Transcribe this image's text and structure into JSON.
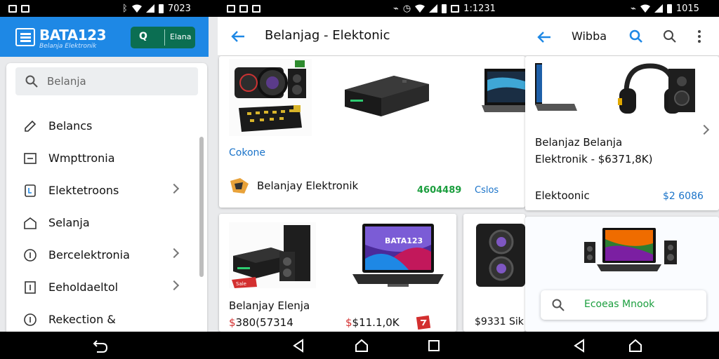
{
  "status_bar": {
    "left_time": "7023",
    "mid_time": "1:1231",
    "right_time": "1015"
  },
  "drawer": {
    "brand": "BATA123",
    "brand_sub": "Belanja Elektronik",
    "header_button": {
      "icon_letter": "Q",
      "label": "Elana"
    },
    "search_placeholder": "Belanja",
    "items": [
      {
        "label": "Belancs",
        "icon": "edit-icon",
        "chevron": false
      },
      {
        "label": "Wmpttronia",
        "icon": "box-icon",
        "chevron": false
      },
      {
        "label": "Elektetroons",
        "icon": "bookmark-icon",
        "chevron": true
      },
      {
        "label": "Selanja",
        "icon": "home-icon",
        "chevron": false
      },
      {
        "label": "Bercelektronia",
        "icon": "info-icon",
        "chevron": true
      },
      {
        "label": "Eeholdaeltol",
        "icon": "document-icon",
        "chevron": true
      },
      {
        "label": "Rekection &",
        "icon": "info-icon",
        "chevron": false
      }
    ]
  },
  "panel2": {
    "title": "Belanjag - Elektonic",
    "card1": {
      "link": "Cokone",
      "row_title": "Belanjay Elektronik",
      "stat_green": "4604489",
      "stat_blue": "Cslos"
    },
    "card2": {
      "tag": "Sale",
      "name": "Belanjay Elenja",
      "price_prefix": "$",
      "price": "380(57314",
      "screen_text": "BATA123"
    },
    "card3": {
      "price": "$11.1,0K"
    },
    "card4": {
      "price": "$9331 Sik"
    }
  },
  "panel3": {
    "title": "Wibba",
    "product_line1": "Belanjaz Belanja",
    "product_line2": "Elektronik - $6371,8K)",
    "footer_label": "Elektoonic",
    "footer_price": "$2 6086",
    "search_placeholder": "Ecoeas Mnook"
  },
  "colors": {
    "primary_blue": "#1e88e5",
    "header_button_green": "#0b6e52",
    "accent_green": "#1b9e3e",
    "link_blue": "#1a73c9",
    "sale_red": "#d32f2f"
  }
}
